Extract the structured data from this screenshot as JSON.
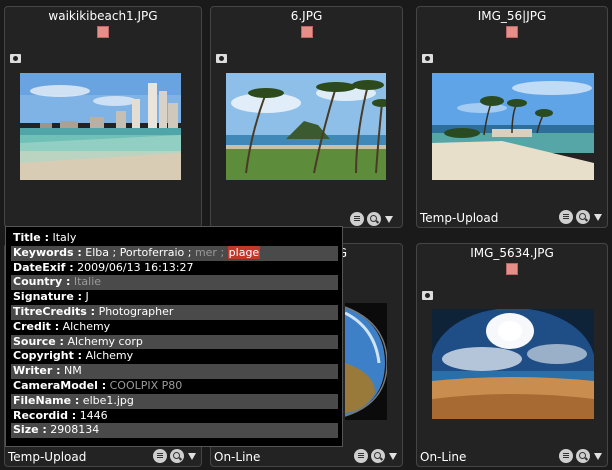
{
  "cards": [
    {
      "filename": "waikikibeach1.JPG",
      "status": ""
    },
    {
      "filename": "6.JPG",
      "status": ""
    },
    {
      "filename": "IMG_56|JPG",
      "status": "Temp-Upload"
    },
    {
      "filename": "",
      "status": "Temp-Upload"
    },
    {
      "filename": "G",
      "status": "On-Line"
    },
    {
      "filename": "IMG_5634.JPG",
      "status": "On-Line"
    }
  ],
  "tooltip": {
    "title": {
      "key": "Title :",
      "value": "Italy"
    },
    "keywords": {
      "key": "Keywords :",
      "part1": "Elba ; Portoferraio ;",
      "part2": "mer ;",
      "part3": "plage"
    },
    "dateexif": {
      "key": "DateExif :",
      "value": "2009/06/13 16:13:27"
    },
    "country": {
      "key": "Country :",
      "value": "Italie"
    },
    "signature": {
      "key": "Signature :",
      "value": "J"
    },
    "titrecredits": {
      "key": "TitreCredits :",
      "value": "Photographer"
    },
    "credit": {
      "key": "Credit :",
      "value": "Alchemy"
    },
    "source": {
      "key": "Source :",
      "value": "Alchemy corp"
    },
    "copyright": {
      "key": "Copyright :",
      "value": "Alchemy"
    },
    "writer": {
      "key": "Writer :",
      "value": "NM"
    },
    "cameramodel": {
      "key": "CameraModel :",
      "value": "COOLPIX P80"
    },
    "filename": {
      "key": "FileName :",
      "value": "elbe1.jpg"
    },
    "recordid": {
      "key": "Recordid :",
      "value": "1446"
    },
    "size": {
      "key": "Size :",
      "value": "2908134"
    }
  },
  "colors": {
    "swatch": "#e88e88",
    "highlight": "#c0392b",
    "background": "#1a1a1a"
  }
}
